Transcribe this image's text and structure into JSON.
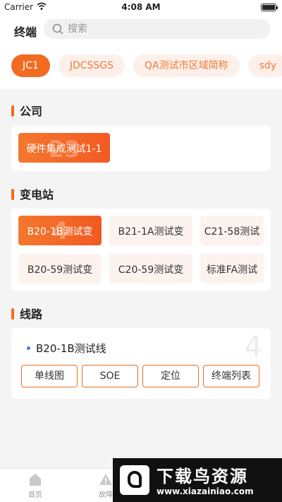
{
  "status": {
    "carrier": "Carrier",
    "time": "4:08 AM"
  },
  "header": {
    "title": "终端",
    "search_placeholder": "搜索"
  },
  "chips": [
    "JC1",
    "JDCSSGS",
    "QA测试市区域简称",
    "sdy"
  ],
  "company": {
    "title": "公司",
    "items": [
      {
        "label": "硬件集成测试1-1",
        "count": "23"
      }
    ]
  },
  "substation": {
    "title": "变电站",
    "items": [
      {
        "label": "B20-1B测试变",
        "count": "4"
      },
      {
        "label": "B21-1A测试变"
      },
      {
        "label": "C21-58测试"
      },
      {
        "label": "B20-59测试变"
      },
      {
        "label": "C20-59测试变"
      },
      {
        "label": "标准FA测试"
      }
    ]
  },
  "line": {
    "title": "线路",
    "name": "B20-1B测试线",
    "count": "4",
    "buttons": [
      "单线图",
      "SOE",
      "定位",
      "终端列表"
    ]
  },
  "tabs": [
    "首页",
    "故障"
  ],
  "watermark": {
    "main": "下载鸟资源",
    "sub": "www.xiazainiao.com"
  },
  "colors": {
    "accent": "#f26b21",
    "chip_bg": "#fdf0ea",
    "bullet": "#3b7de9"
  }
}
